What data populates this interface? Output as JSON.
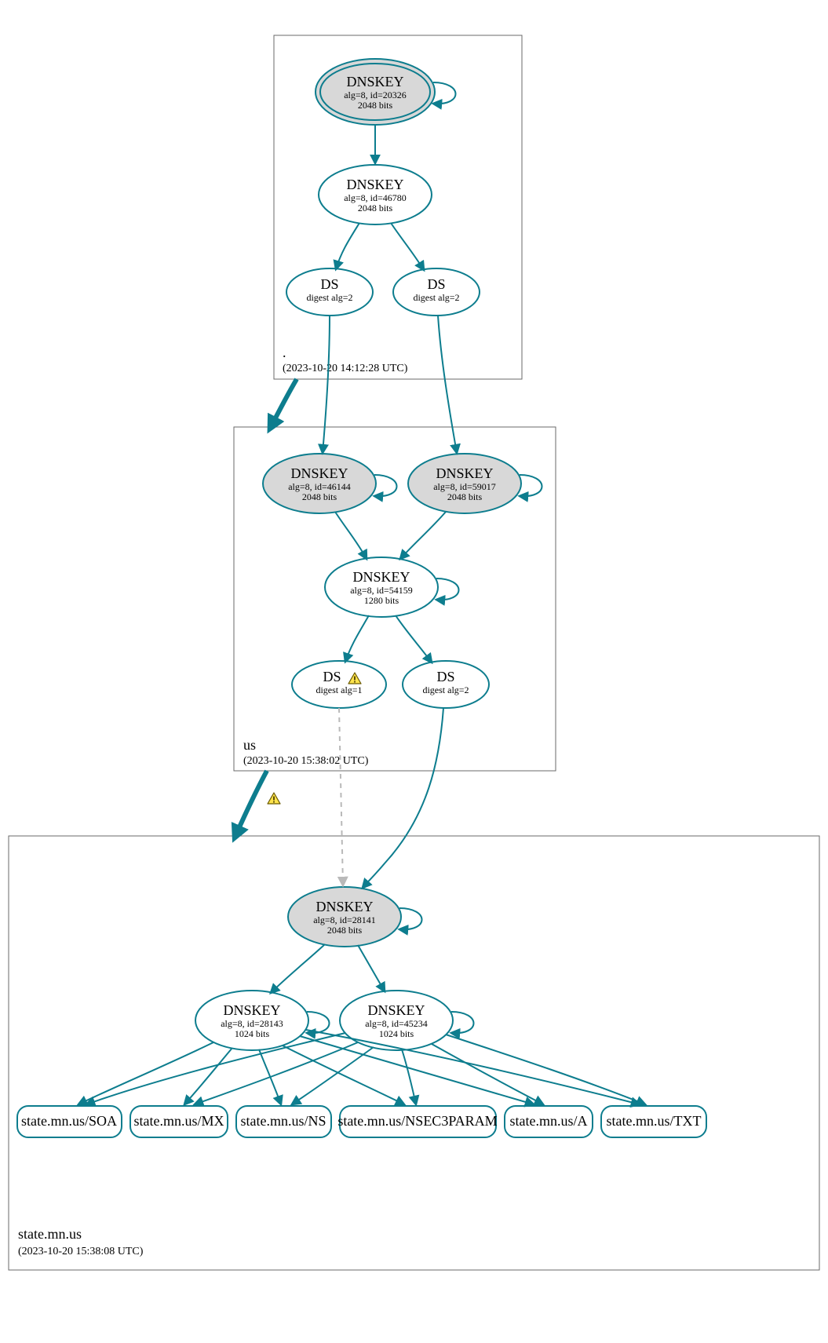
{
  "colors": {
    "stroke": "#0d7d8e",
    "node_fill_grey": "#d8d8d8",
    "node_fill_white": "#ffffff",
    "box_stroke": "#6a6a6a",
    "dashed_stroke": "#b9b9b9"
  },
  "zones": {
    "root": {
      "name": ".",
      "timestamp": "(2023-10-20 14:12:28 UTC)"
    },
    "us": {
      "name": "us",
      "timestamp": "(2023-10-20 15:38:02 UTC)"
    },
    "leaf": {
      "name": "state.mn.us",
      "timestamp": "(2023-10-20 15:38:08 UTC)"
    }
  },
  "nodes": {
    "root_ksk": {
      "title": "DNSKEY",
      "line1": "alg=8, id=20326",
      "line2": "2048 bits"
    },
    "root_zsk": {
      "title": "DNSKEY",
      "line1": "alg=8, id=46780",
      "line2": "2048 bits"
    },
    "root_ds1": {
      "title": "DS",
      "line1": "digest alg=2"
    },
    "root_ds2": {
      "title": "DS",
      "line1": "digest alg=2"
    },
    "us_ksk1": {
      "title": "DNSKEY",
      "line1": "alg=8, id=46144",
      "line2": "2048 bits"
    },
    "us_ksk2": {
      "title": "DNSKEY",
      "line1": "alg=8, id=59017",
      "line2": "2048 bits"
    },
    "us_zsk": {
      "title": "DNSKEY",
      "line1": "alg=8, id=54159",
      "line2": "1280 bits"
    },
    "us_ds1": {
      "title": "DS",
      "line1": "digest alg=1"
    },
    "us_ds2": {
      "title": "DS",
      "line1": "digest alg=2"
    },
    "leaf_ksk": {
      "title": "DNSKEY",
      "line1": "alg=8, id=28141",
      "line2": "2048 bits"
    },
    "leaf_zsk1": {
      "title": "DNSKEY",
      "line1": "alg=8, id=28143",
      "line2": "1024 bits"
    },
    "leaf_zsk2": {
      "title": "DNSKEY",
      "line1": "alg=8, id=45234",
      "line2": "1024 bits"
    }
  },
  "records": {
    "r0": "state.mn.us/SOA",
    "r1": "state.mn.us/MX",
    "r2": "state.mn.us/NS",
    "r3": "state.mn.us/NSEC3PARAM",
    "r4": "state.mn.us/A",
    "r5": "state.mn.us/TXT"
  },
  "icons": {
    "warning": "warning-icon"
  }
}
